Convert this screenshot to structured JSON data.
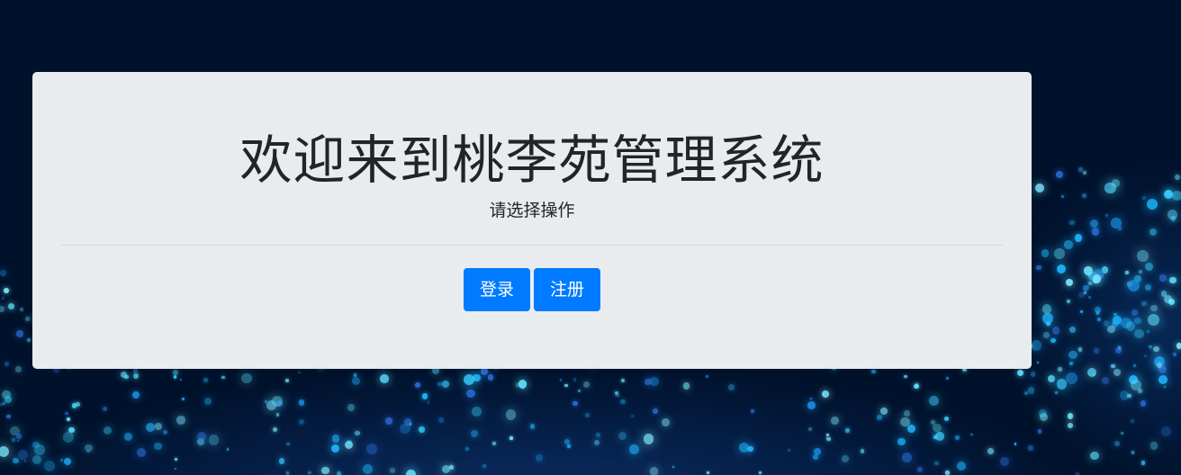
{
  "jumbotron": {
    "title": "欢迎来到桃李苑管理系统",
    "lead": "请选择操作"
  },
  "actions": {
    "login_label": "登录",
    "register_label": "注册"
  },
  "colors": {
    "background": "#00112b",
    "panel": "#e9ecef",
    "primary": "#007bff",
    "text": "#212529"
  }
}
